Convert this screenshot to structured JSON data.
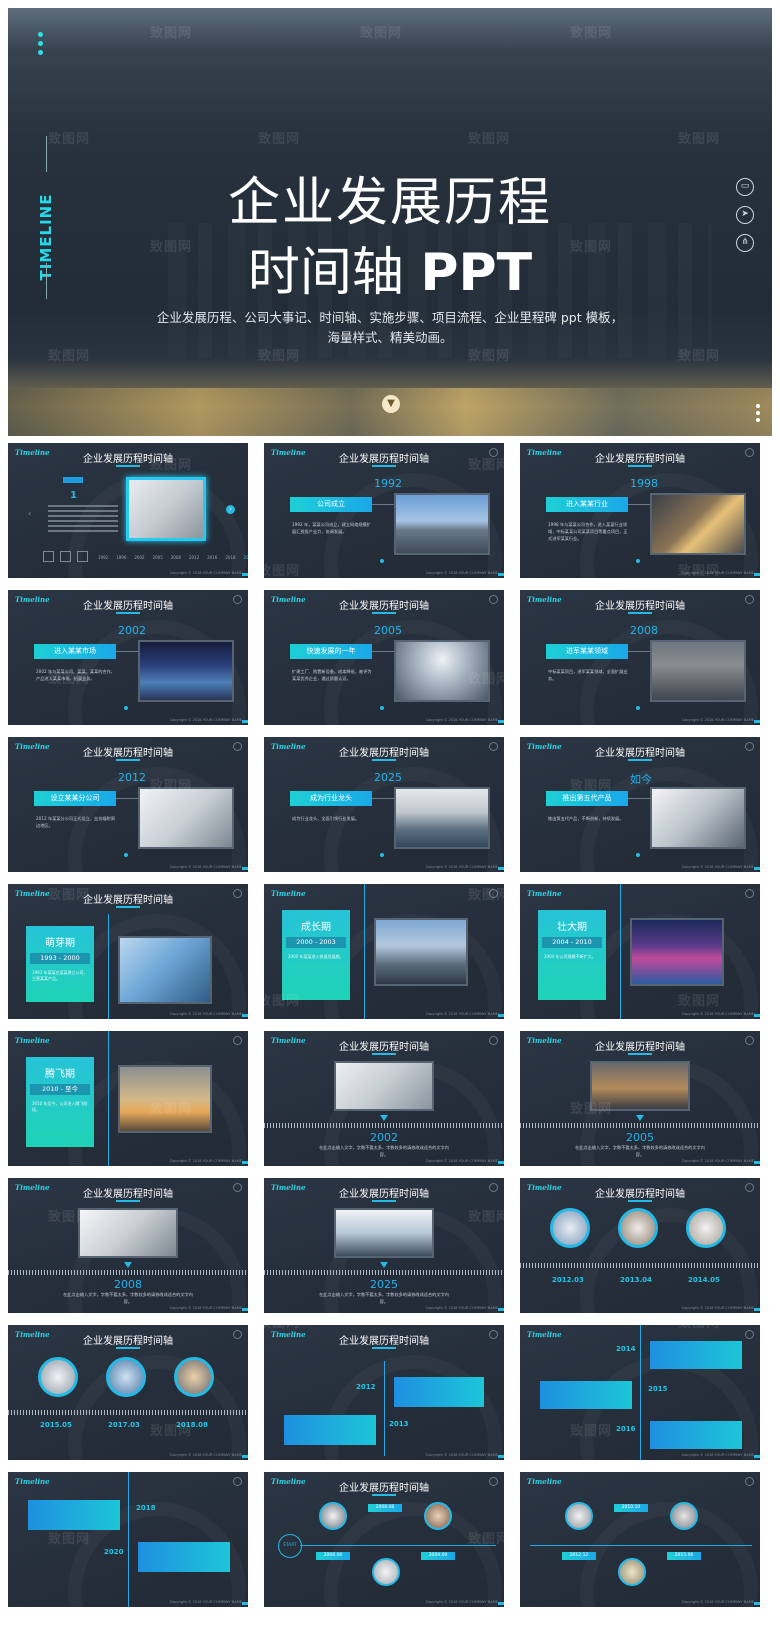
{
  "hero": {
    "vertical_title": "TIMELINE",
    "title_line1": "企业发展历程",
    "title_line2_cn": "时间轴",
    "title_line2_en": "PPT",
    "subtitle_line1": "企业发展历程、公司大事记、时间轴、实施步骤、项目流程、企业里程碑 ppt 模板，",
    "subtitle_line2": "海量样式、精美动画。",
    "icons": [
      "laptop-icon",
      "paper-plane-icon",
      "network-icon"
    ],
    "down_icon": "chevron-down-icon"
  },
  "watermark": "致图网",
  "watermark_sub": "zhitu88.com",
  "common": {
    "logo": "Timeline",
    "slide_title": "企业发展历程时间轴",
    "copyright": "Copyright © 2018 YOUR COMPANY NAME"
  },
  "s1": {
    "number": "1",
    "years": [
      "1992",
      "1996",
      "2002",
      "2005",
      "2008",
      "2012",
      "2016",
      "2018",
      "2020"
    ]
  },
  "milestones": [
    {
      "year": "1992",
      "label": "公司成立",
      "text": "1992 年，某某公司成立，建立网络规模扩展汇拢投产业力，协调发展。"
    },
    {
      "year": "1998",
      "label": "进入某某行业",
      "text": "1998 年与某某公司合作，进入某某行业领域，中标某某公司某某项目等重点项目，正式进军某某行业。"
    },
    {
      "year": "2002",
      "label": "进入某某市场",
      "text": "2002 年与某某公司、某某、某某的合作，产品进入某某市场，拓展业务。"
    },
    {
      "year": "2005",
      "label": "快速发展的一年",
      "text": "扩建工厂、购置新设备，成本降低，被评为某某优秀企业，通过质量认证。"
    },
    {
      "year": "2008",
      "label": "进军某某领域",
      "text": "中标某某项目，进军某某领域，全面扩展业务。"
    },
    {
      "year": "2012",
      "label": "设立某某分公司",
      "text": "2012 年某某分公司正式设立，业务辐射周边地区。"
    },
    {
      "year": "2025",
      "label": "成为行业龙头",
      "text": "成为行业龙头，全面引领行业发展。"
    },
    {
      "year": "如今",
      "label": "推出第五代产品",
      "text": "推出第五代产品，不断创新，持续发展。"
    }
  ],
  "stages": [
    {
      "name": "萌芽期",
      "period": "1993 - 2000",
      "text": "1993 年某某在某某建立公司，主营某某产品。"
    },
    {
      "name": "成长期",
      "period": "2000 - 2003",
      "text": "2000 年某某进入快速发展期。"
    },
    {
      "name": "壮大期",
      "period": "2004 - 2010",
      "text": "2004 年公司规模不断扩大。"
    },
    {
      "name": "腾飞期",
      "period": "2010 - 至今",
      "text": "2010 年至今，公司进入腾飞阶段。"
    }
  ],
  "axis_slides": [
    {
      "year": "2002",
      "text": "在此点击输入文字，字数不要太多，字数较多的请修改成适合的文字内容。"
    },
    {
      "year": "2005",
      "text": "在此点击输入文字，字数不要太多，字数较多的请修改成适合的文字内容。"
    },
    {
      "year": "2008",
      "text": "在此点击输入文字，字数不要太多，字数较多的请修改成适合的文字内容。"
    },
    {
      "year": "2025",
      "text": "在此点击输入文字，字数不要太多，字数较多的请修改成适合的文字内容。"
    }
  ],
  "circle_slides": [
    {
      "dates": [
        "2012.03",
        "2013.04",
        "2014.05"
      ]
    },
    {
      "dates": [
        "2015.05",
        "2017.03",
        "2018.08"
      ]
    }
  ],
  "zigzag_a": {
    "years": [
      "2012",
      "2013"
    ]
  },
  "zigzag_b": {
    "years": [
      "2014",
      "2015",
      "2016"
    ]
  },
  "zigzag_c": {
    "years": [
      "2018",
      "2020"
    ]
  },
  "start_slides": [
    {
      "start": "START",
      "labels": [
        "2006.06",
        "2008.08",
        "2009.09"
      ]
    },
    {
      "labels": [
        "2010.10",
        "2012.12",
        "2015.06"
      ]
    }
  ]
}
